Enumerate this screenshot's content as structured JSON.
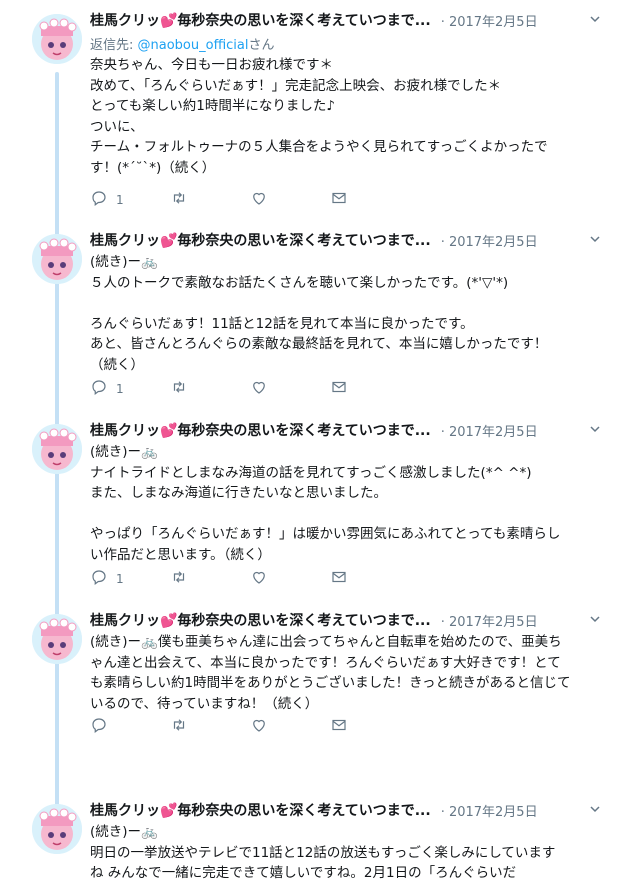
{
  "tweets": [
    {
      "name": "桂馬クリッ💕毎秒奈央の思いを深く考えていつまで...",
      "date": "· 2017年2月5日",
      "reply_prefix": "返信先: ",
      "reply_handle": "@naobou_official",
      "reply_suffix": "さん",
      "lines": [
        "奈央ちゃん、今日も一日お疲れ様です＊",
        "改めて、「ろんぐらいだぁす！」完走記念上映会、お疲れ様でした＊",
        "とっても楽しい約1時間半になりました♪",
        "ついに、",
        "チーム・フォルトゥーナの５人集合をようやく見られてすっごくよかったで",
        "す！(*´˘`*)（続く）"
      ],
      "reply_count": "1",
      "retweet_count": "",
      "like_count": ""
    },
    {
      "name": "桂馬クリッ💕毎秒奈央の思いを深く考えていつまで...",
      "date": "· 2017年2月5日",
      "lines": [
        "(続き)ー🚲",
        "５人のトークで素敵なお話たくさんを聴いて楽しかったです。(*'▽'*)",
        "",
        "ろんぐらいだぁす！11話と12話を見れて本当に良かったです。",
        "あと、皆さんとろんぐらの素敵な最終話を見れて、本当に嬉しかったです！",
        "（続く）"
      ],
      "reply_count": "1",
      "retweet_count": "",
      "like_count": ""
    },
    {
      "name": "桂馬クリッ💕毎秒奈央の思いを深く考えていつまで...",
      "date": "· 2017年2月5日",
      "lines": [
        "(続き)ー🚲",
        "ナイトライドとしまなみ海道の話を見れてすっごく感激しました(*^ ^*)",
        "また、しまなみ海道に行きたいなと思いました。",
        "",
        "やっぱり「ろんぐらいだぁす！」は暖かい雰囲気にあふれてとっても素晴らし",
        "い作品だと思います。（続く）"
      ],
      "reply_count": "1",
      "retweet_count": "",
      "like_count": ""
    },
    {
      "name": "桂馬クリッ💕毎秒奈央の思いを深く考えていつまで...",
      "date": "· 2017年2月5日",
      "lines": [
        "(続き)ー🚲僕も亜美ちゃん達に出会ってちゃんと自転車を始めたので、亜美ち",
        "ゃん達と出会えて、本当に良かったです！ろんぐらいだぁす大好きです！とて",
        "も素晴らしい約1時間半をありがとうございました！きっと続きがあると信じて",
        "いるので、待っていますね！（続く）"
      ],
      "reply_count": "",
      "retweet_count": "",
      "like_count": ""
    },
    {
      "name": "桂馬クリッ💕毎秒奈央の思いを深く考えていつまで...",
      "date": "· 2017年2月5日",
      "lines": [
        "(続き)ー🚲",
        "明日の一挙放送やテレビで11話と12話の放送もすっごく楽しみにしています",
        "ね みんなで一緒に完走できて嬉しいですね。2月1日の「ろんぐらいだ"
      ],
      "reply_count": "",
      "retweet_count": "",
      "like_count": ""
    }
  ]
}
